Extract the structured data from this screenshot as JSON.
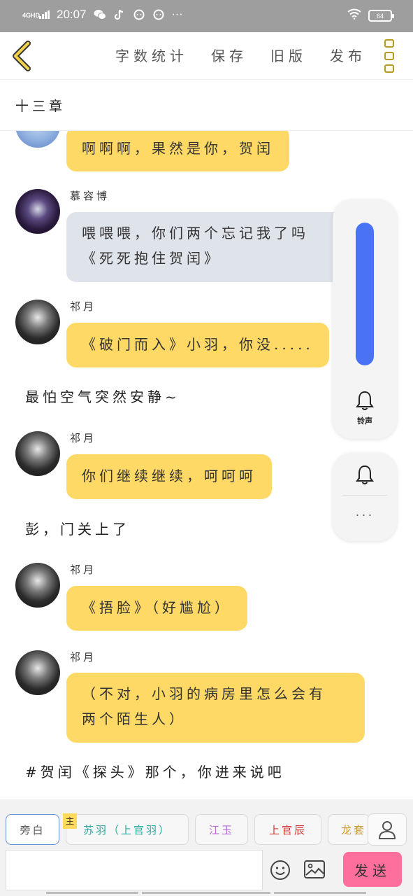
{
  "status_bar": {
    "time": "20:07",
    "network": "4GHD",
    "battery": "64",
    "icons": [
      "wechat-icon",
      "tiktok-icon",
      "chat-bubble-icon",
      "chat-bubble-icon",
      "more-dots-icon",
      "wifi-icon"
    ],
    "more": "···"
  },
  "toolbar": {
    "back_icon": "chevron-left-icon",
    "word_count": "字数统计",
    "save": "保存",
    "old_version": "旧版",
    "publish": "发布",
    "menu_icon": "vertical-menu-icon"
  },
  "chapter": {
    "title": "十三章"
  },
  "messages": [
    {
      "speaker": "",
      "text": "啊啊啊，果然是你，贺闰",
      "style": "yellow"
    },
    {
      "speaker": "慕容博",
      "text_line1": "喂喂喂，你们两个忘记我了吗",
      "text_line2": "《死死抱住贺闰》",
      "style": "grey"
    },
    {
      "speaker": "祁月",
      "text": "《破门而入》小羽，你没.....",
      "style": "yellow"
    },
    {
      "narration": "最怕空气突然安静~"
    },
    {
      "speaker": "祁月",
      "text": "你们继续继续，呵呵呵",
      "style": "yellow"
    },
    {
      "narration": "彭，门关上了"
    },
    {
      "speaker": "祁月",
      "text": "《捂脸》（好尴尬）",
      "style": "yellow"
    },
    {
      "speaker": "祁月",
      "text_line1": "（不对，小羽的病房里怎么会有",
      "text_line2": "两个陌生人）",
      "style": "yellow"
    },
    {
      "narration": "#贺闰《探头》那个，你进来说吧"
    }
  ],
  "volume_panel": {
    "level_percent": 100,
    "ringtone_label": "铃声",
    "bell_icon": "bell-icon",
    "more": "···"
  },
  "composer": {
    "roles": [
      {
        "label": "旁白",
        "color": "#555555"
      },
      {
        "label": "苏羽（上官羽）",
        "color": "#2aa7a0"
      },
      {
        "label": "江玉",
        "color": "#b36bd6"
      },
      {
        "label": "上官辰",
        "color": "#d0342c"
      },
      {
        "label": "龙套",
        "color": "#c99a2e"
      }
    ],
    "main_badge": "主",
    "input_value": "",
    "send_label": "发送",
    "accent": "#ff6f9e"
  }
}
